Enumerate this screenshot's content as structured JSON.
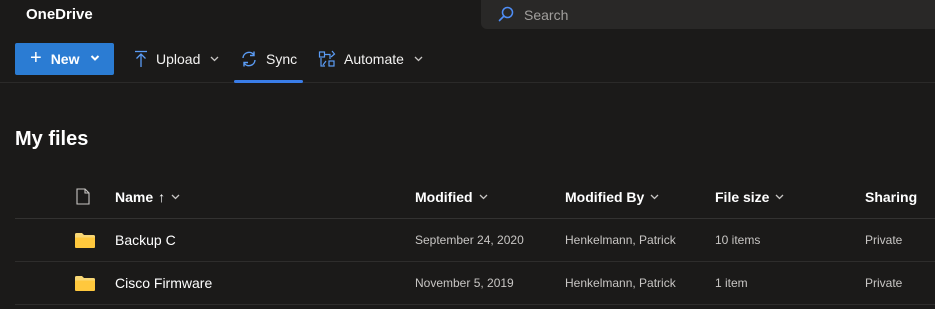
{
  "app": {
    "title": "OneDrive"
  },
  "search": {
    "placeholder": "Search"
  },
  "commands": {
    "new_label": "New",
    "upload_label": "Upload",
    "sync_label": "Sync",
    "automate_label": "Automate"
  },
  "page": {
    "title": "My files"
  },
  "table": {
    "columns": {
      "name": "Name",
      "sort_indicator": "↑",
      "modified": "Modified",
      "modified_by": "Modified By",
      "file_size": "File size",
      "sharing": "Sharing"
    },
    "rows": [
      {
        "name": "Backup C",
        "modified": "September 24, 2020",
        "modified_by": "Henkelmann, Patrick",
        "file_size": "10 items",
        "sharing": "Private",
        "icon": "folder-icon"
      },
      {
        "name": "Cisco Firmware",
        "modified": "November 5, 2019",
        "modified_by": "Henkelmann, Patrick",
        "file_size": "1 item",
        "sharing": "Private",
        "icon": "folder-icon"
      }
    ]
  },
  "colors": {
    "background": "#1b1a19",
    "accent": "#2b7cd3",
    "folder": "#f8d775",
    "sync_underline": "#3a7de8"
  }
}
